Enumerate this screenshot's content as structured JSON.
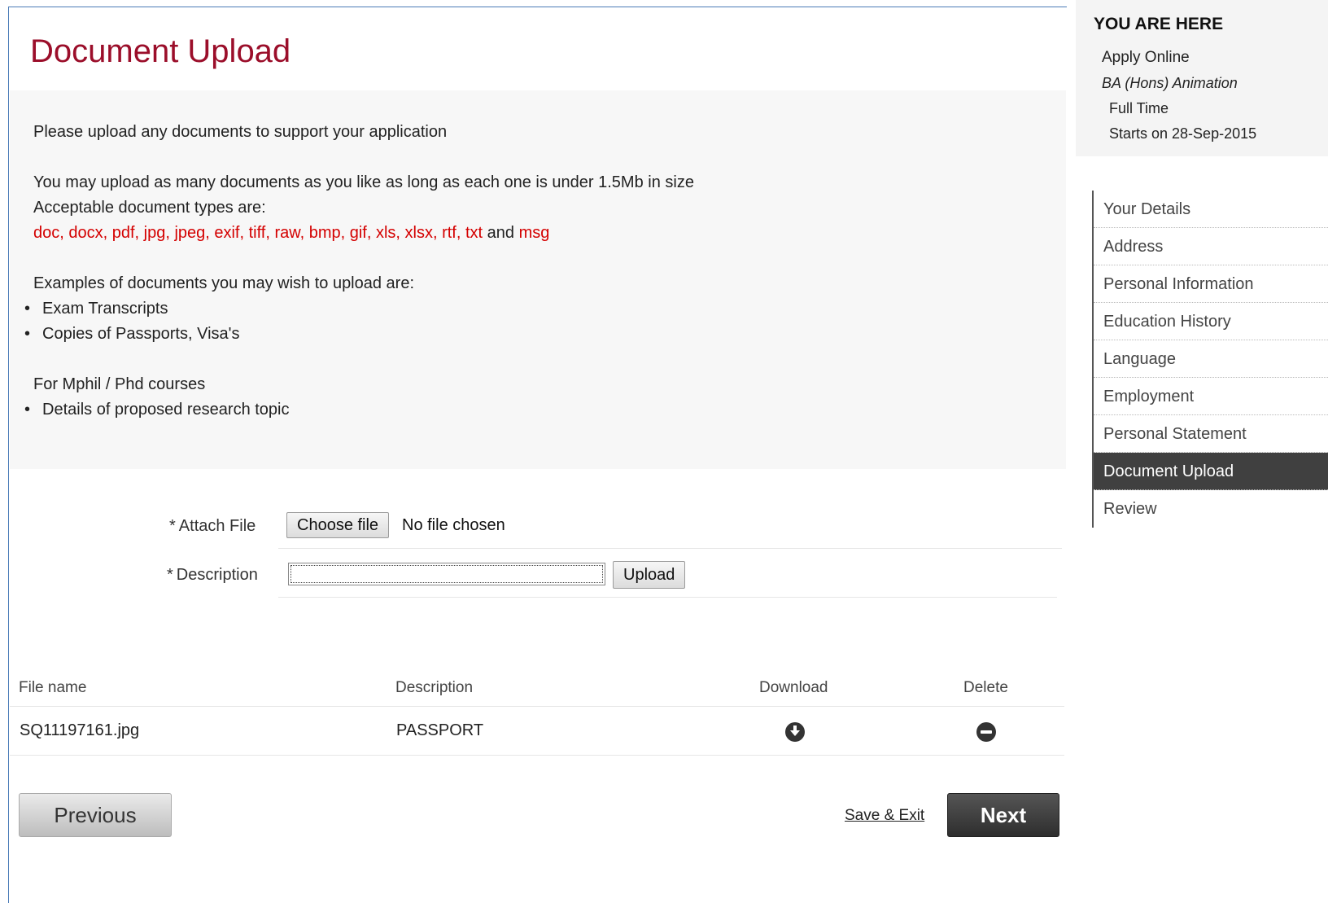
{
  "page": {
    "title": "Document Upload"
  },
  "info": {
    "intro": "Please upload any documents to support your application",
    "size_note": "You may upload as many documents as you like as long as each one is under 1.5Mb in size",
    "types_label": "Acceptable document types are:",
    "types_list": "doc, docx, pdf,  jpg,  jpeg, exif, tiff, raw, bmp, gif, xls, xlsx, rtf, txt",
    "types_and": " and ",
    "types_last": "msg",
    "examples_label": "Examples of documents you may wish to upload are:",
    "examples": [
      "Exam Transcripts",
      "Copies of Passports, Visa's"
    ],
    "mphil_label": "For Mphil / Phd courses",
    "mphil_items": [
      "Details of proposed research topic"
    ]
  },
  "form": {
    "required_mark": "*",
    "attach_label": "Attach File",
    "choose_button": "Choose file",
    "no_file": "No file chosen",
    "description_label": "Description",
    "description_value": "",
    "upload_button": "Upload"
  },
  "table": {
    "headers": {
      "file_name": "File name",
      "description": "Description",
      "download": "Download",
      "delete": "Delete"
    },
    "rows": [
      {
        "file_name": "SQ11197161.jpg",
        "description": "PASSPORT",
        "download_icon": "download-circle-icon",
        "delete_icon": "minus-circle-icon"
      }
    ]
  },
  "footer": {
    "previous": "Previous",
    "save_exit": "Save & Exit",
    "next": "Next"
  },
  "sidebar": {
    "here_title": "YOU ARE HERE",
    "apply": "Apply Online",
    "course": "BA (Hons) Animation",
    "mode": "Full Time",
    "start": "Starts on 28-Sep-2015",
    "nav": [
      "Your Details",
      "Address",
      "Personal Information",
      "Education History",
      "Language",
      "Employment",
      "Personal Statement",
      "Document Upload",
      "Review"
    ],
    "active_index": 7
  },
  "colors": {
    "title": "#9b0e2a",
    "types": "#d40000",
    "active_nav": "#404040",
    "border": "#4a7bb7"
  }
}
